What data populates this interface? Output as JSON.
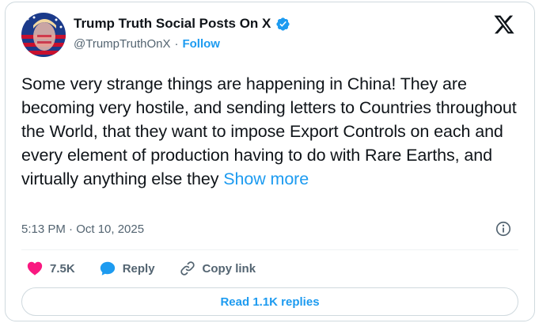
{
  "author": {
    "display_name": "Trump Truth Social Posts On X",
    "handle": "@TrumpTruthOnX",
    "separator": "·",
    "follow_label": "Follow"
  },
  "post": {
    "text": "Some very strange things are happening in China! They are becoming very hostile, and sending letters to Countries throughout the World, that they want to impose Export Controls on each and every element of production having to do with Rare Earths, and virtually anything else they",
    "show_more_label": "Show more",
    "timestamp": "5:13 PM · Oct 10, 2025"
  },
  "actions": {
    "like_count": "7.5K",
    "reply_label": "Reply",
    "copy_link_label": "Copy link"
  },
  "read_replies_label": "Read 1.1K replies",
  "colors": {
    "accent": "#1d9bf0",
    "like": "#f91880",
    "text": "#0f1419",
    "muted": "#536471"
  },
  "icons": [
    "avatar-image",
    "verified-badge-icon",
    "x-logo-icon",
    "info-icon",
    "heart-icon",
    "reply-bubble-icon",
    "link-icon"
  ]
}
